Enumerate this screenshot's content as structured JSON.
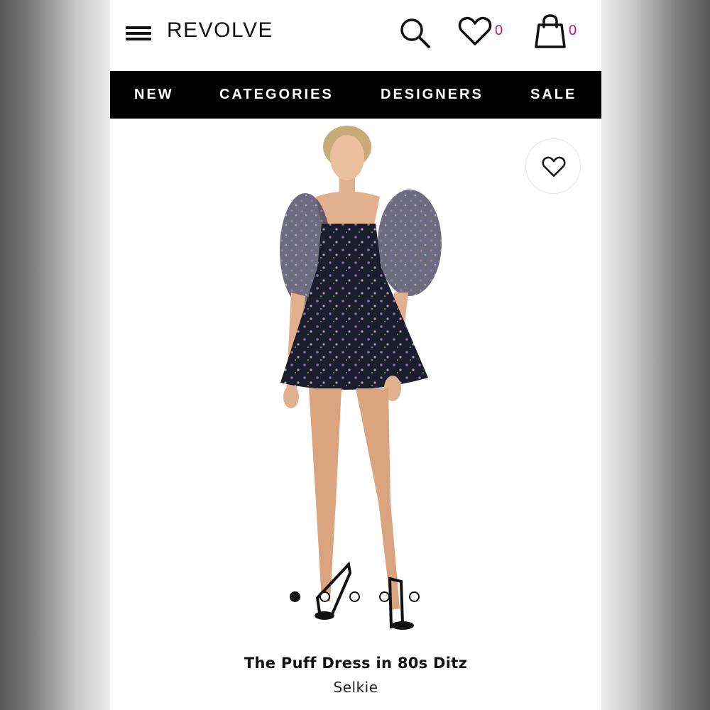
{
  "header": {
    "logo": "REVOLVE",
    "wishlist_count": "0",
    "bag_count": "0"
  },
  "nav": {
    "items": [
      "NEW",
      "CATEGORIES",
      "DESIGNERS",
      "SALE"
    ]
  },
  "gallery": {
    "image_count": 5,
    "active_index": 0
  },
  "product": {
    "name": "The Puff Dress in 80s Ditz",
    "brand": "Selkie"
  },
  "colors": {
    "accent": "#c2188b",
    "nav_bg": "#000000",
    "dress": "#1c1d2e",
    "print": "#8a6fa8"
  }
}
